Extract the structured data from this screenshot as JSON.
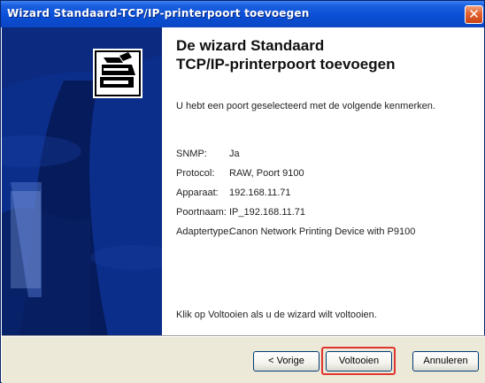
{
  "window": {
    "title": "Wizard Standaard-TCP/IP-printerpoort toevoegen",
    "close_glyph": "✕"
  },
  "content": {
    "heading_line1": "De wizard Standaard",
    "heading_line2": "TCP/IP-printerpoort toevoegen",
    "intro": "U hebt een poort geselecteerd met de volgende kenmerken.",
    "properties": [
      {
        "label": "SNMP:",
        "value": "Ja"
      },
      {
        "label": "Protocol:",
        "value": "RAW, Poort 9100"
      },
      {
        "label": "Apparaat:",
        "value": "192.168.11.71"
      },
      {
        "label": "Poortnaam:",
        "value": "IP_192.168.11.71"
      },
      {
        "label": "Adaptertype:",
        "value": "Canon Network Printing Device with P9100"
      }
    ],
    "finish_note": "Klik op Voltooien als u de wizard wilt voltooien."
  },
  "buttons": {
    "back": "< Vorige",
    "finish": "Voltooien",
    "cancel": "Annuleren"
  },
  "icons": {
    "wizard_illustration": "printer-wizard-icon"
  },
  "colors": {
    "titlebar": "#0a4fd6",
    "side_pane": "#0a2472",
    "highlight": "#e0342e",
    "close_button": "#e2612f"
  }
}
